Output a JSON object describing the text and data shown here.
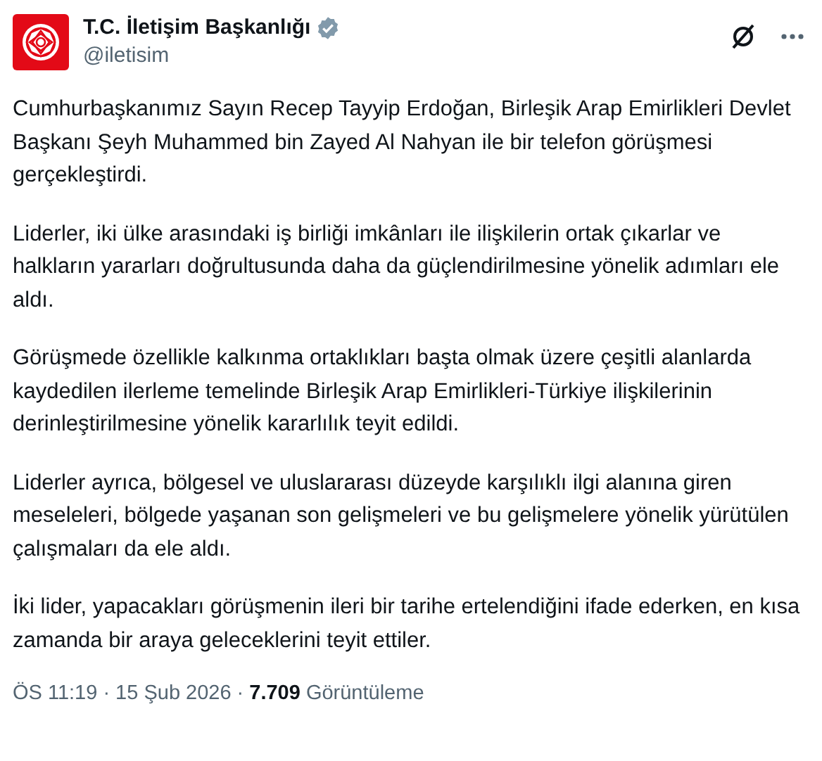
{
  "author": {
    "name": "T.C. İletişim Başkanlığı",
    "verified": true,
    "handle": "@iletisim"
  },
  "paragraphs": [
    "Cumhurbaşkanımız Sayın Recep Tayyip Erdoğan, Birleşik Arap Emirlikleri Devlet Başkanı Şeyh Muhammed bin Zayed Al Nahyan ile bir telefon görüşmesi gerçekleştirdi.",
    "Liderler, iki ülke arasındaki iş birliği imkânları ile ilişkilerin ortak çıkarlar ve halkların yararları doğrultusunda daha da güçlendirilmesine yönelik adımları ele aldı.",
    "Görüşmede özellikle kalkınma ortaklıkları başta olmak üzere çeşitli alanlarda kaydedilen ilerleme temelinde Birleşik Arap Emirlikleri-Türkiye ilişkilerinin derinleştirilmesine yönelik kararlılık teyit edildi.",
    "Liderler ayrıca, bölgesel ve uluslararası düzeyde karşılıklı ilgi alanına giren meseleleri, bölgede yaşanan son gelişmeleri ve bu gelişmelere yönelik yürütülen çalışmaları da ele aldı.",
    "İki lider, yapacakları görüşmenin ileri bir tarihe ertelendiğini ifade ederken, en kısa zamanda bir araya geleceklerini teyit ettiler."
  ],
  "footer": [
    {
      "kind": "time",
      "text": "ÖS 11:19"
    },
    {
      "kind": "separator",
      "text": "·"
    },
    {
      "kind": "date",
      "text": "15 Şub 2026"
    },
    {
      "kind": "separator",
      "text": "·"
    },
    {
      "kind": "count",
      "text": "7.709"
    },
    {
      "kind": "label",
      "text": "Görüntüleme"
    }
  ]
}
